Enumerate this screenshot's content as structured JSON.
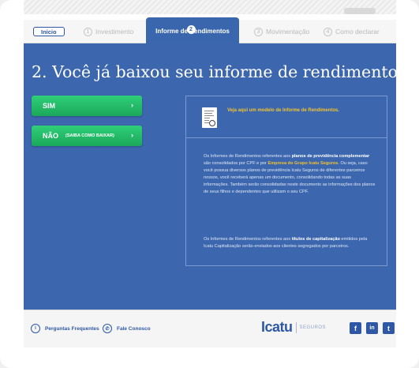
{
  "tabs": [
    {
      "label": "Início"
    },
    {
      "num": "1",
      "label": "Investimento"
    },
    {
      "num": "2",
      "label": "Informe de Rendimentos"
    },
    {
      "num": "3",
      "label": "Movimentação"
    },
    {
      "num": "4",
      "label": "Como declarar"
    }
  ],
  "main": {
    "title": "2. Você já baixou seu informe de rendimentos?",
    "btn_sim": "SIM",
    "btn_nao": "NÃO",
    "btn_nao_sub": "(SAIBA COMO BAIXAR)",
    "arrow": "›"
  },
  "info": {
    "link": "Veja aqui um modelo de Informe de Rendimentos.",
    "p1_a": "Os Informes de Rendimentos referentes aos ",
    "p1_b": "planos de previdência complementar",
    "p1_c": " são consolidados por CPF e por ",
    "p1_d": "Empresa do Grupo Icatu Seguros",
    "p1_e": ". Ou seja, caso você possua diversos planos de previdência Icatu Seguros de diferentes parceiros nossos, você receberá apenas um documento, consolidando todas as suas informações. Também serão consolidadas neste documento as informações dos planos de seus filhos e dependentes que utilizam o seu CPF.",
    "p2_a": "Os Informes de Rendimentos referentes aos ",
    "p2_b": "títulos de capitalização",
    "p2_c": " emitidos pela Icatu Capitalização serão enviados aos clientes segregados por parceiros."
  },
  "footer": {
    "faq": "Perguntas Frequentes",
    "contact": "Fale Conosco",
    "brand": "Icatu",
    "brand_sub": "SEGUROS",
    "social": [
      "f",
      "in",
      "t"
    ]
  },
  "colors": {
    "primary": "#3c67ae",
    "accent": "#f2c230",
    "button": "#21b866"
  }
}
